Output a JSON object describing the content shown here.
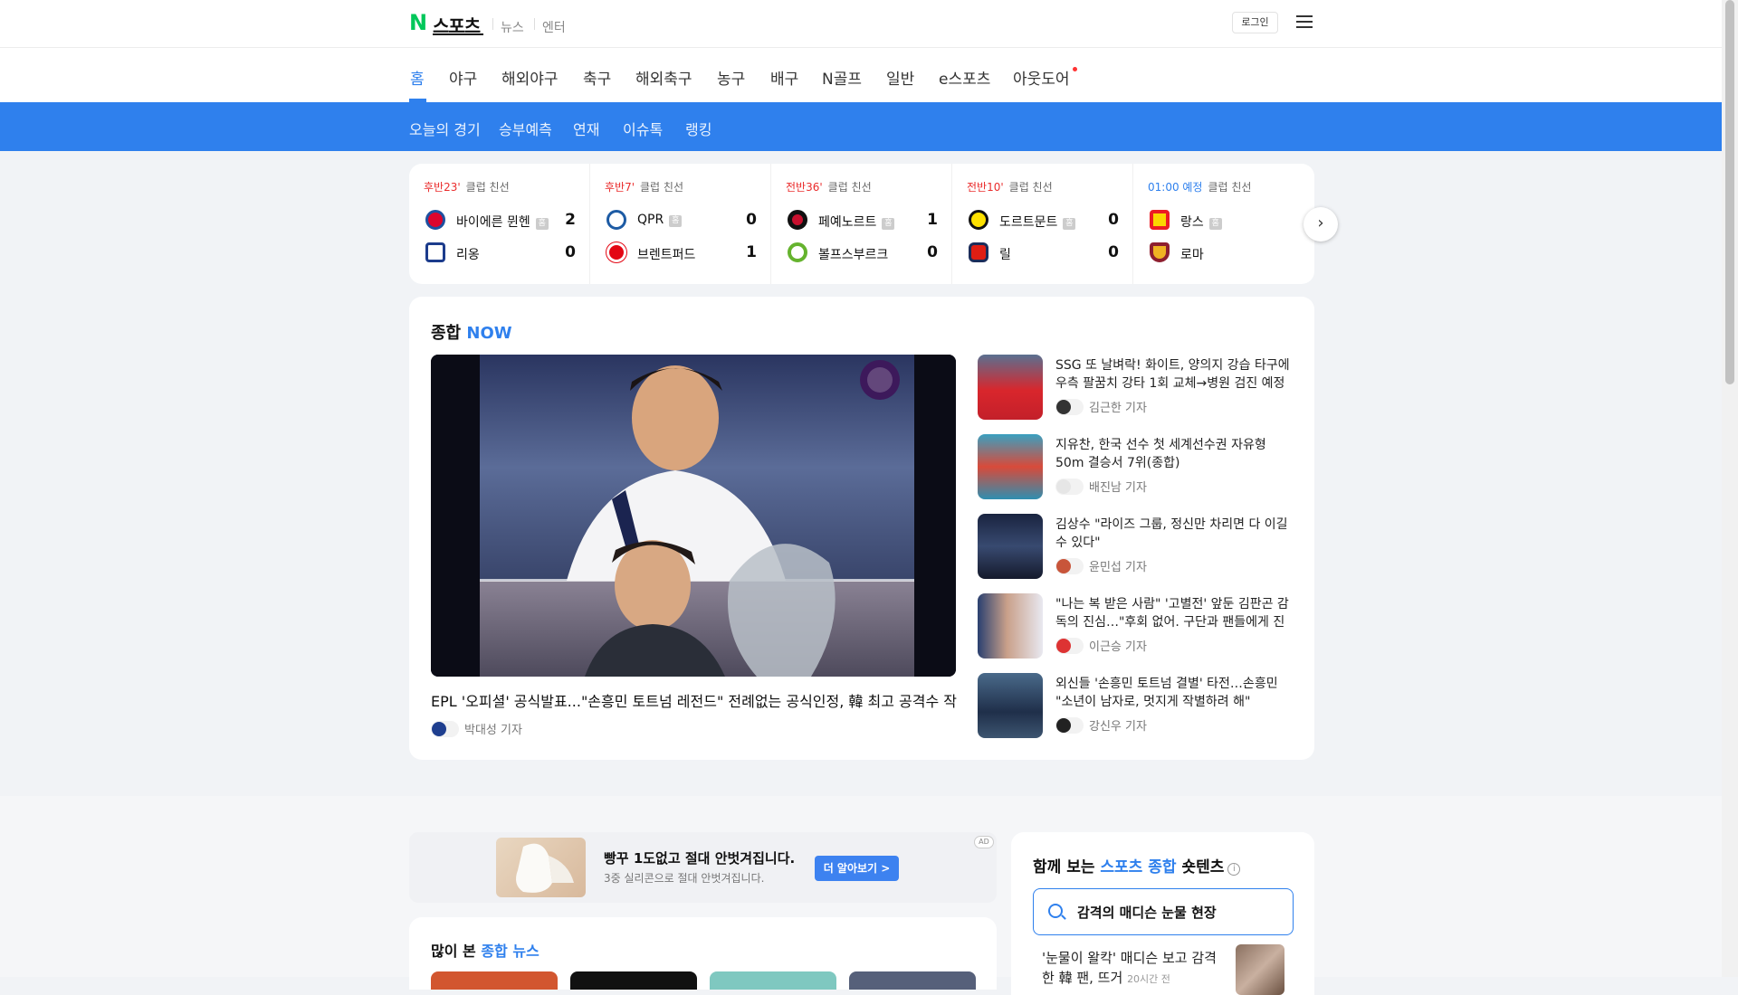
{
  "header": {
    "logo_letter": "N",
    "logo_text": "스포츠",
    "links": [
      "뉴스",
      "엔터"
    ],
    "login_label": "로그인"
  },
  "nav": {
    "items": [
      "홈",
      "야구",
      "해외야구",
      "축구",
      "해외축구",
      "농구",
      "배구",
      "N골프",
      "일반",
      "e스포츠",
      "아웃도어"
    ],
    "active_index": 0
  },
  "subnav": {
    "items": [
      "오늘의 경기",
      "승부예측",
      "연재",
      "이슈톡",
      "랭킹"
    ]
  },
  "scoreboard": {
    "home_badge": "홈",
    "matches": [
      {
        "status": "후반23'",
        "status_type": "live",
        "league": "클럽 친선",
        "home": {
          "name": "바이에른 뮌헨",
          "score": "2",
          "color": "#dc052d"
        },
        "away": {
          "name": "리옹",
          "score": "0",
          "color": "#1c3c8c"
        }
      },
      {
        "status": "후반7'",
        "status_type": "live",
        "league": "클럽 친선",
        "home": {
          "name": "QPR",
          "score": "0",
          "color": "#1d5ba4"
        },
        "away": {
          "name": "브렌트퍼드",
          "score": "1",
          "color": "#e30613"
        }
      },
      {
        "status": "전반36'",
        "status_type": "live",
        "league": "클럽 친선",
        "home": {
          "name": "페예노르트",
          "score": "1",
          "color": "#c8102e"
        },
        "away": {
          "name": "볼프스부르크",
          "score": "0",
          "color": "#65b32e"
        }
      },
      {
        "status": "전반10'",
        "status_type": "live",
        "league": "클럽 친선",
        "home": {
          "name": "도르트문트",
          "score": "0",
          "color": "#fde100"
        },
        "away": {
          "name": "릴",
          "score": "0",
          "color": "#e01e13"
        }
      },
      {
        "status": "01:00 예정",
        "status_type": "scheduled",
        "league": "클럽 친선",
        "home": {
          "name": "랑스",
          "score": "",
          "color": "#ec1c24"
        },
        "away": {
          "name": "로마",
          "score": "",
          "color": "#8e1f2f"
        }
      }
    ]
  },
  "now": {
    "title_main": "종합",
    "title_accent": "NOW",
    "hero": {
      "title": "EPL '오피셜' 공식발표...\"손흥민 토트넘 레전드\" 전례없는 공식인정, 韓 최고 공격수 작별에 경의",
      "reporter": "박대성 기자"
    },
    "news": [
      {
        "title": "SSG 또 날벼락! 화이트, 양의지 강습 타구에 우측 팔꿈치 강타 1회 교체→병원 검진 예정 (잠실 현장)",
        "reporter": "김근한 기자"
      },
      {
        "title": "지유찬, 한국 선수 첫 세계선수권 자유형 50m 결승서 7위(종합)",
        "reporter": "배진남 기자"
      },
      {
        "title": "김상수 \"라이즈 그룹, 정신만 차리면 다 이길 수 있다\"",
        "reporter": "윤민섭 기자"
      },
      {
        "title": "\"나는 복 받은 사람\" '고별전' 앞둔 김판곤 감독의 진심…\"후회 없어. 구단과 팬들에게 진심으로 감사\"",
        "reporter": "이근승 기자"
      },
      {
        "title": "외신들 '손흥민 토트넘 결별' 타전…손흥민 \"소년이 남자로, 멋지게 작별하려 해\"",
        "reporter": "강신우 기자"
      }
    ]
  },
  "ad": {
    "tag": "AD",
    "title": "빵꾸 1도없고 절대 안벗겨집니다.",
    "desc": "3중 실리콘으로 절대 안벗겨집니다.",
    "cta": "더 알아보기 >"
  },
  "popular": {
    "title_main": "많이 본",
    "title_accent": "종합 뉴스"
  },
  "shorts": {
    "title_pre": "함께 보는",
    "title_accent": "스포츠 종합",
    "title_post": "숏텐츠",
    "info": "i",
    "search_text": "감격의 매디슨 눈물 현장",
    "item_text": "'눈물이 왈칵' 매디슨 보고 감격한 韓 팬, 뜨거",
    "item_time": "20시간 전"
  },
  "colors": {
    "accent": "#2f80ed",
    "live": "#ea2d2d",
    "naver_green": "#03c75a"
  }
}
